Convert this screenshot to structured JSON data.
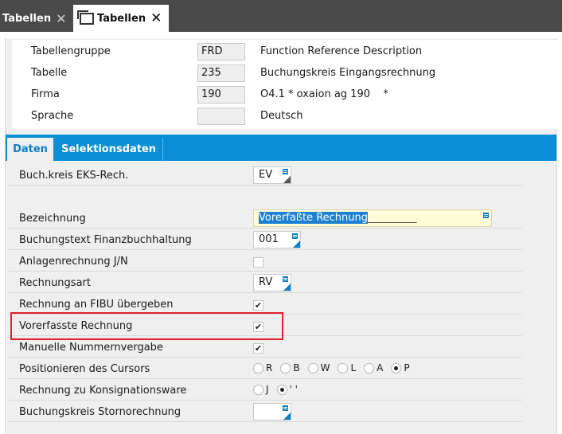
{
  "tabs": [
    {
      "label": "Tabellen",
      "active": false
    },
    {
      "label": "Tabellen",
      "active": true
    }
  ],
  "header_fields": [
    {
      "label": "Tabellengruppe",
      "value": "FRD",
      "description": "Function Reference Description"
    },
    {
      "label": "Tabelle",
      "value": "235",
      "description": "Buchungskreis Eingangsrechnung"
    },
    {
      "label": "Firma",
      "value": "190",
      "description": "O4.1 * oxaion ag 190    *"
    },
    {
      "label": "Sprache",
      "value": "",
      "description": "Deutsch"
    }
  ],
  "content_tabs": [
    "Daten",
    "Selektionsdaten"
  ],
  "form": {
    "buchkreis": {
      "label": "Buch.kreis EKS-Rech.",
      "value": "EV"
    },
    "bezeichnung": {
      "label": "Bezeichnung",
      "value": "Vorerfaßte Rechnung",
      "trailing": "___________"
    },
    "buchungstext": {
      "label": "Buchungstext Finanzbuchhaltung",
      "value": "001"
    },
    "anlagen": {
      "label": "Anlagenrechnung J/N",
      "checked": false
    },
    "rechnungsart": {
      "label": "Rechnungsart",
      "value": "RV"
    },
    "fibu": {
      "label": "Rechnung an FIBU übergeben",
      "checked": true
    },
    "vorerfasst": {
      "label": "Vorerfasste Rechnung",
      "checked": true
    },
    "manuell": {
      "label": "Manuelle Nummernvergabe",
      "checked": true
    },
    "cursor": {
      "label": "Positionieren des Cursors",
      "options": [
        "R",
        "B",
        "W",
        "L",
        "A",
        "P"
      ],
      "selected": "P"
    },
    "konsignation": {
      "label": "Rechnung zu Konsignationsware",
      "options": [
        "J",
        "' '"
      ],
      "selected": "' '"
    },
    "storno": {
      "label": "Buchungskreis Stornorechnung",
      "value": ""
    }
  },
  "check_mark": "✔",
  "close_glyph": "✕",
  "colors": {
    "accent": "#0a8fd6",
    "highlight_box": "#e0232a",
    "tabbar": "#4a4a4a"
  }
}
